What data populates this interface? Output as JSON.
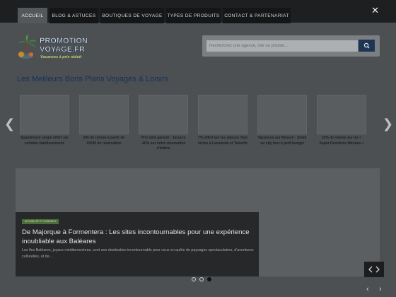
{
  "nav": {
    "tabs": [
      {
        "label": "Accueil"
      },
      {
        "label": "Blog & Astuces"
      },
      {
        "label": "Boutiques de voyage"
      },
      {
        "label": "Types de produits"
      },
      {
        "label": "Contact & Partenariat"
      }
    ],
    "close_glyph": "✕"
  },
  "logo": {
    "line1": "PROMOTION",
    "line2": "VOYAGE.FR",
    "tagline": "Vacances à prix réduit"
  },
  "search": {
    "placeholder": "Recherchez une agence, site ou produit..."
  },
  "heading": "Les Meilleurs Bons Plans Voyages & Loisirs",
  "carousel": {
    "prev_glyph": "❮",
    "next_glyph": "❯",
    "deals": [
      {
        "caption": "Supplément single offert sur certains établissements"
      },
      {
        "caption": "50€ de remise à partir de 1500€ de réservation"
      },
      {
        "caption": "Prix mini garanti : Jusqu'à -40% sur votre réservation d'hôtels"
      },
      {
        "caption": "7% offert sur les séjours Tout inclus à Lanzarote et Tenerife"
      },
      {
        "caption": "Vacances sur Mesure : Soleil ou city tour à petit budget"
      },
      {
        "caption": "15% de remise sur les « Super Dernières Minutes »"
      }
    ]
  },
  "hero": {
    "badge": "Actualité et conseils",
    "title": "De Majorque à Formentera : Les sites incontournables pour une expérience inoubliable aux Baléares",
    "excerpt": "Les îles Baléares, joyaux méditerranéens, sont une destination incontournable pour ceux en quête de paysages spectaculaires, d'aventures culturelles, et de...",
    "active_slide": 3
  },
  "icons": {
    "search": "search-icon",
    "close": "close-icon",
    "prev": "chevron-left-icon",
    "next": "chevron-right-icon",
    "palm": "palm-tree-icon"
  },
  "colors": {
    "nav_bg": "#1e1f20",
    "active_tab": "#55585a",
    "heading": "#15315a",
    "search_button": "#1d3554",
    "badge": "#4c6e3a"
  }
}
